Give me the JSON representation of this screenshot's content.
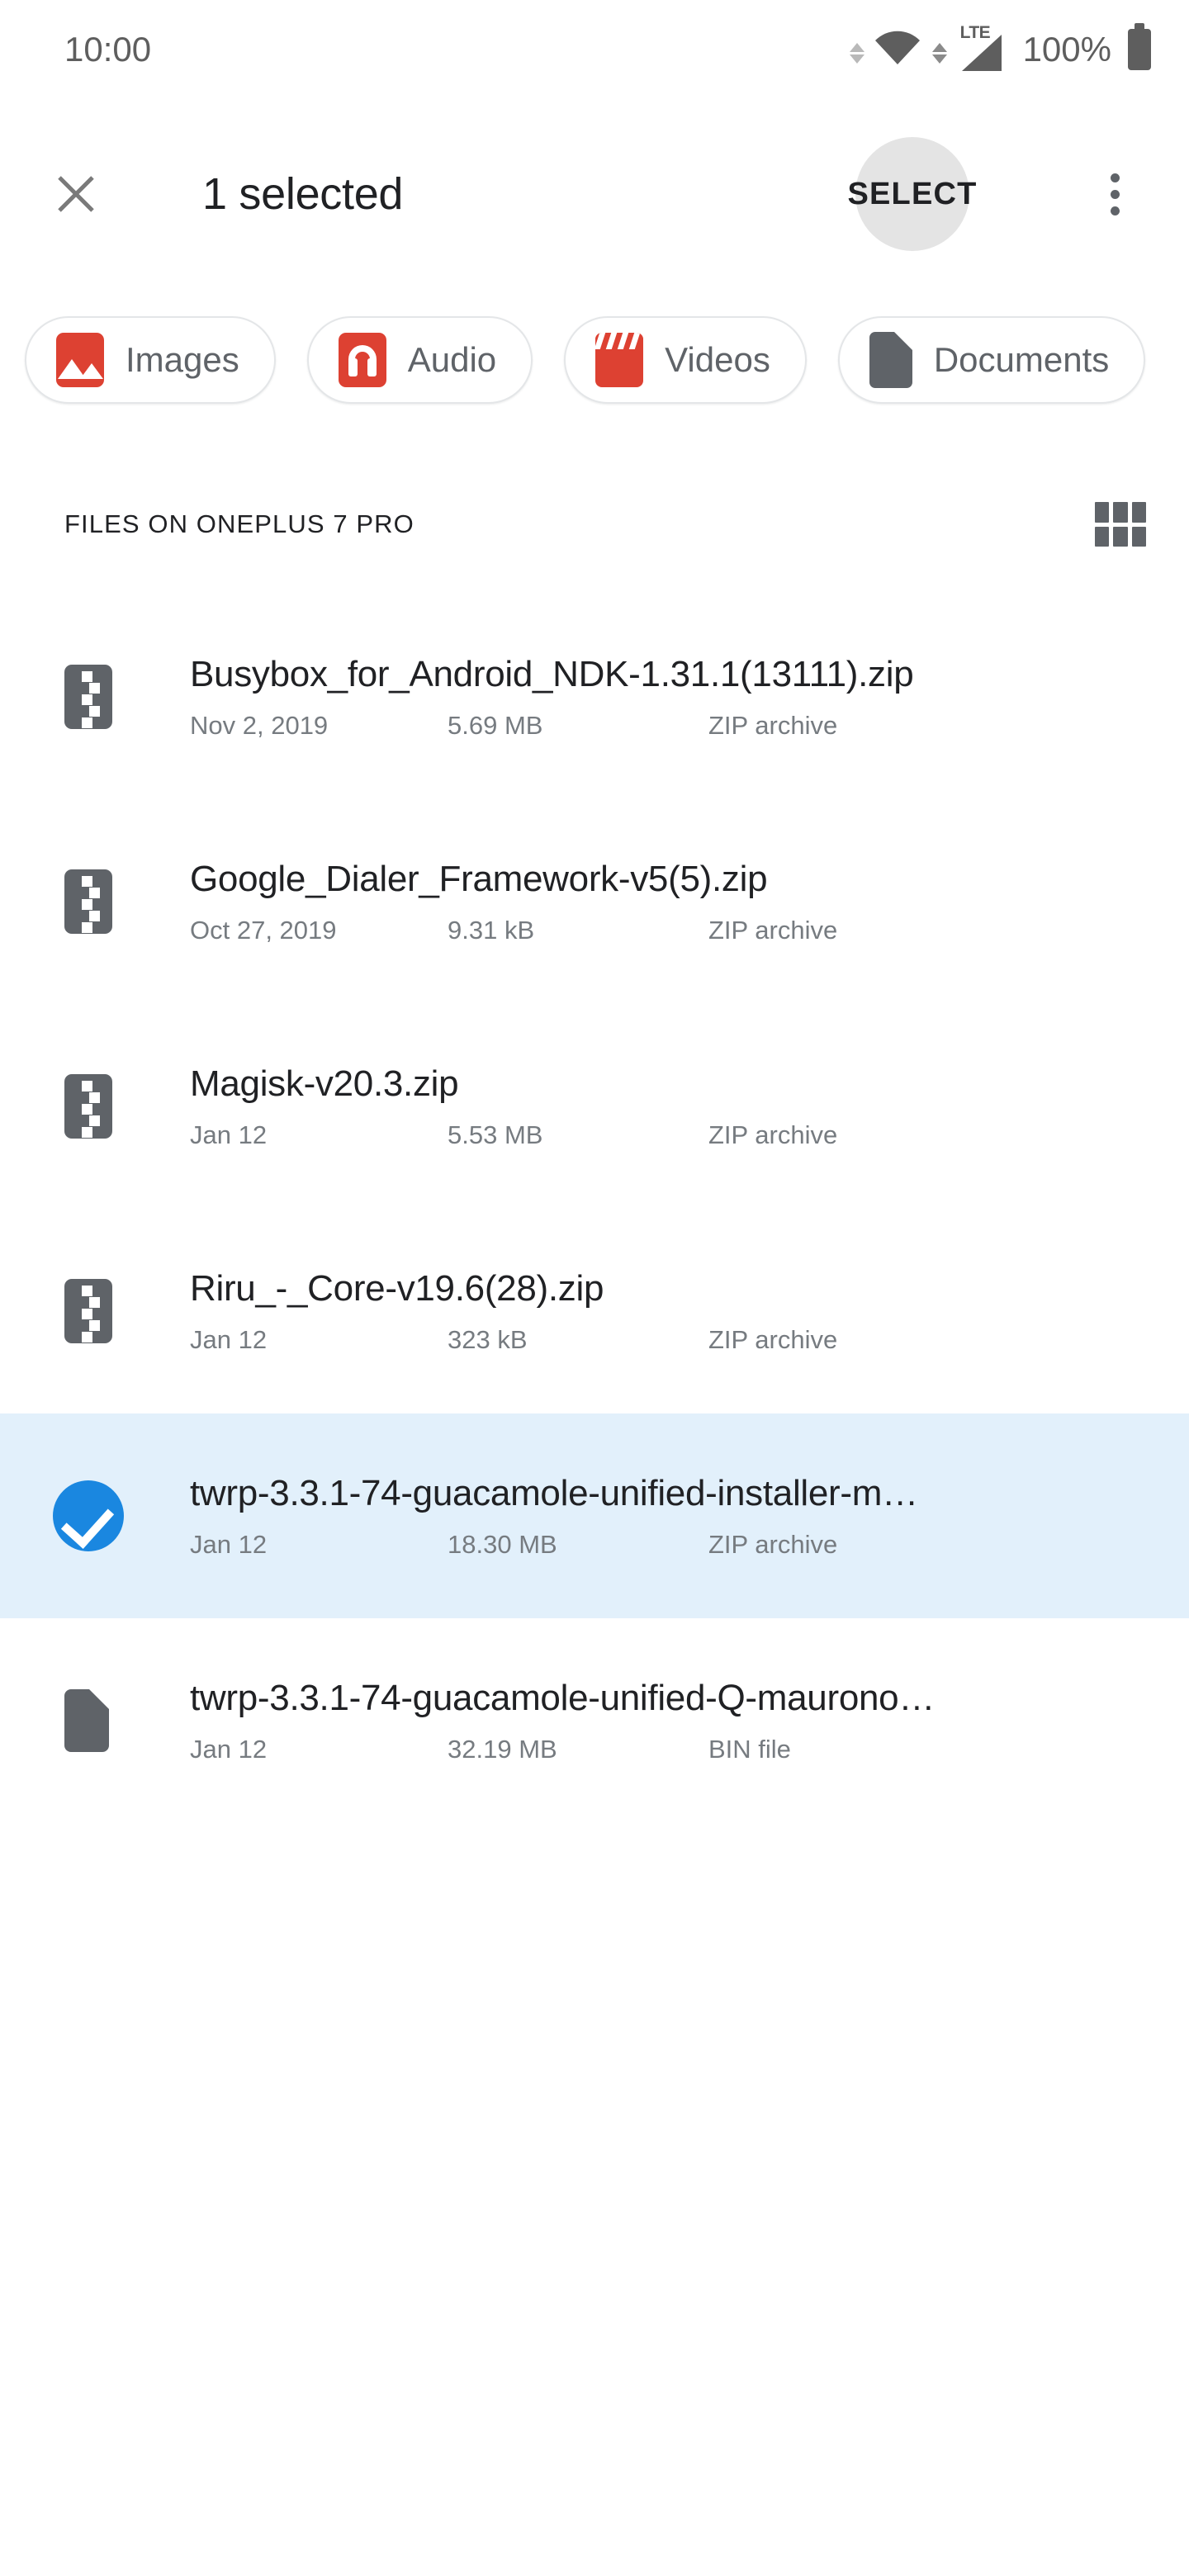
{
  "status_bar": {
    "clock": "10:00",
    "battery_percent": "100%",
    "signal_label": "LTE",
    "icons": [
      "wifi-icon",
      "lte-signal-icon",
      "battery-icon"
    ]
  },
  "app_bar": {
    "close_icon": "close-icon",
    "title": "1 selected",
    "select_label": "SELECT",
    "overflow_icon": "overflow-menu-icon"
  },
  "chips": [
    {
      "label": "Images",
      "icon": "images-icon",
      "color": "#dd4132"
    },
    {
      "label": "Audio",
      "icon": "audio-icon",
      "color": "#dd4132"
    },
    {
      "label": "Videos",
      "icon": "videos-icon",
      "color": "#dd4132"
    },
    {
      "label": "Documents",
      "icon": "documents-icon",
      "color": "#5f6368"
    }
  ],
  "section": {
    "title": "FILES ON ONEPLUS 7 PRO",
    "view_toggle_icon": "grid-view-icon"
  },
  "files": [
    {
      "name": "Busybox_for_Android_NDK-1.31.1(13111).zip",
      "date": "Nov 2, 2019",
      "size": "5.69 MB",
      "type": "ZIP archive",
      "icon": "zip-file-icon",
      "selected": false
    },
    {
      "name": "Google_Dialer_Framework-v5(5).zip",
      "date": "Oct 27, 2019",
      "size": "9.31 kB",
      "type": "ZIP archive",
      "icon": "zip-file-icon",
      "selected": false
    },
    {
      "name": "Magisk-v20.3.zip",
      "date": "Jan 12",
      "size": "5.53 MB",
      "type": "ZIP archive",
      "icon": "zip-file-icon",
      "selected": false
    },
    {
      "name": "Riru_-_Core-v19.6(28).zip",
      "date": "Jan 12",
      "size": "323 kB",
      "type": "ZIP archive",
      "icon": "zip-file-icon",
      "selected": false
    },
    {
      "name": "twrp-3.3.1-74-guacamole-unified-installer-m…",
      "date": "Jan 12",
      "size": "18.30 MB",
      "type": "ZIP archive",
      "icon": "check-selected-icon",
      "selected": true
    },
    {
      "name": "twrp-3.3.1-74-guacamole-unified-Q-maurono…",
      "date": "Jan 12",
      "size": "32.19 MB",
      "type": "BIN file",
      "icon": "bin-file-icon",
      "selected": false
    }
  ],
  "colors": {
    "accent_red": "#dd4132",
    "selection_blue": "#1a87e0",
    "selected_row_bg": "#e2f0fb",
    "icon_gray": "#5f6368",
    "text_primary": "#202124",
    "text_secondary": "#767b80"
  }
}
